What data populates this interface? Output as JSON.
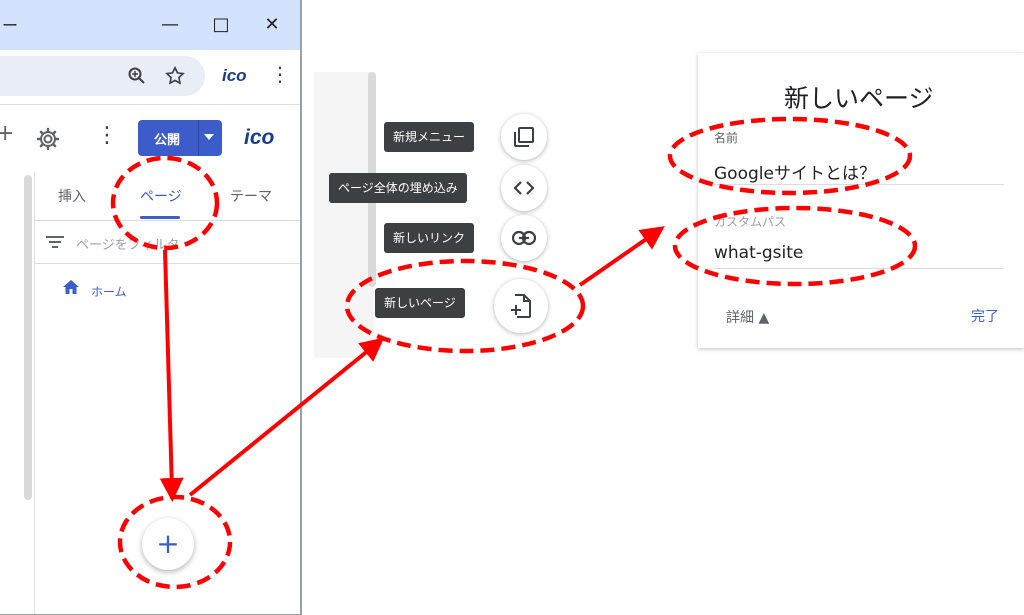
{
  "browser": {
    "titlebar_partial": "ー",
    "controls": {
      "minimize": "—",
      "maximize": "□",
      "close": "✕"
    },
    "zoom_icon": "zoom-icon",
    "star_icon": "star-icon",
    "extension_logo": "ico",
    "menu_dots": "⋮"
  },
  "sites_toolbar": {
    "add_partial": "+",
    "settings_icon": "gear-icon",
    "more_dots": "⋮",
    "publish_label": "公開",
    "logo": "ico"
  },
  "right_panel": {
    "tabs": [
      {
        "label": "挿入"
      },
      {
        "label": "ページ"
      },
      {
        "label": "テーマ"
      }
    ],
    "filter_placeholder": "ページをフィルタ",
    "pages": [
      {
        "label": "ホーム",
        "icon": "home-icon"
      }
    ]
  },
  "fab": {
    "label": "+"
  },
  "menu": {
    "items": [
      {
        "label": "新規メニュー",
        "icon": "copy-icon"
      },
      {
        "label": "ページ全体の埋め込み",
        "icon": "code-icon"
      },
      {
        "label": "新しいリンク",
        "icon": "link-icon"
      },
      {
        "label": "新しいページ",
        "icon": "new-page-icon"
      }
    ]
  },
  "dialog": {
    "title": "新しいページ",
    "name_label": "名前",
    "name_value": "Googleサイトとは？",
    "path_label": "カスタムパス",
    "path_value": "what-gsite",
    "details_label": "詳細 ▲",
    "done_label": "完了"
  },
  "colors": {
    "accent": "#3c5cc9",
    "annotation": "#ff0000",
    "chip": "#3c4043"
  }
}
